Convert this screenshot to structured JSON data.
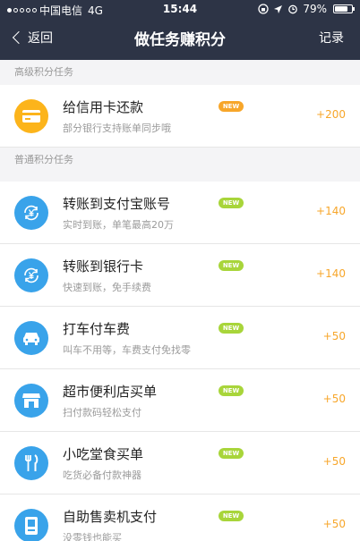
{
  "status_bar": {
    "carrier": "中国电信",
    "network": "4G",
    "time": "15:44",
    "battery": "79%",
    "battery_level": 0.79
  },
  "nav": {
    "back_label": "返回",
    "title": "做任务赚积分",
    "right_label": "记录"
  },
  "sections": [
    {
      "title": "高级积分任务",
      "items": [
        {
          "title": "给信用卡还款",
          "subtitle": "部分银行支持账单同步哦",
          "badge": "NEW",
          "points": "+200",
          "icon": "credit-card-icon",
          "icon_color": "#fcb41b"
        }
      ]
    },
    {
      "title": "普通积分任务",
      "items": [
        {
          "title": "转账到支付宝账号",
          "subtitle": "实时到账，单笔最高20万",
          "badge": "NEW",
          "points": "+140",
          "icon": "yuan-transfer-icon",
          "icon_color": "#39a3ea"
        },
        {
          "title": "转账到银行卡",
          "subtitle": "快速到账，免手续费",
          "badge": "NEW",
          "points": "+140",
          "icon": "yuan-transfer-icon",
          "icon_color": "#39a3ea"
        },
        {
          "title": "打车付车费",
          "subtitle": "叫车不用等，车费支付免找零",
          "badge": "NEW",
          "points": "+50",
          "icon": "taxi-icon",
          "icon_color": "#39a3ea"
        },
        {
          "title": "超市便利店买单",
          "subtitle": "扫付款码轻松支付",
          "badge": "NEW",
          "points": "+50",
          "icon": "store-icon",
          "icon_color": "#39a3ea"
        },
        {
          "title": "小吃堂食买单",
          "subtitle": "吃货必备付款神器",
          "badge": "NEW",
          "points": "+50",
          "icon": "fork-knife-icon",
          "icon_color": "#39a3ea"
        },
        {
          "title": "自助售卖机支付",
          "subtitle": "没零钱也能买",
          "badge": "NEW",
          "points": "+50",
          "icon": "vending-machine-icon",
          "icon_color": "#39a3ea"
        }
      ]
    }
  ]
}
